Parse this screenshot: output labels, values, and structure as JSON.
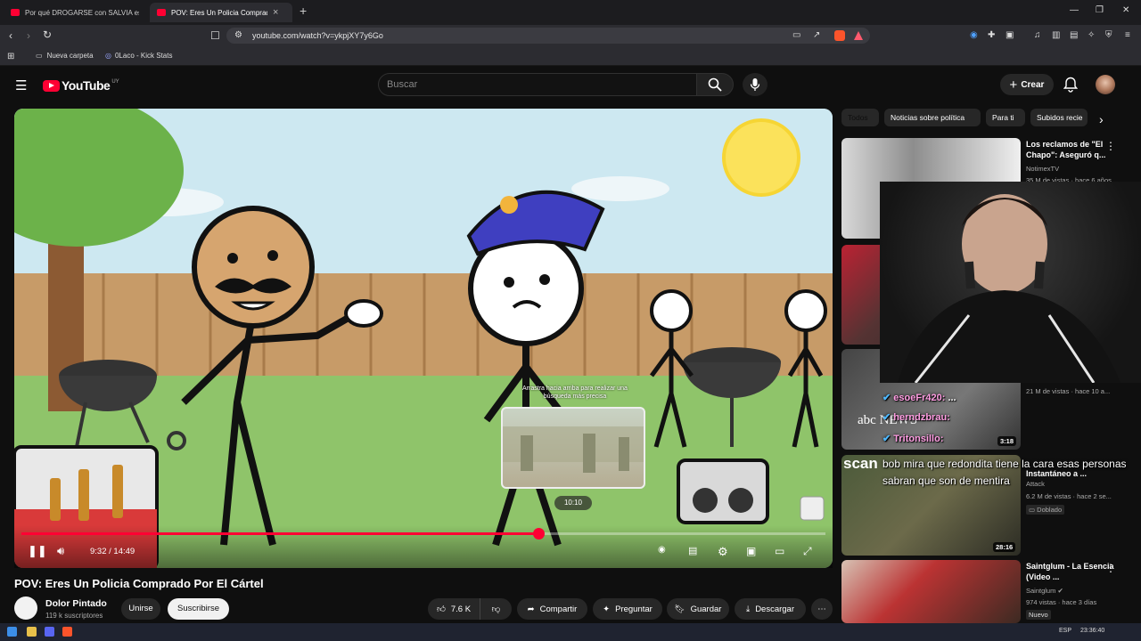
{
  "browser": {
    "tabs": [
      {
        "label": "Por qué DROGARSE con SALVIA es lo",
        "active": false
      },
      {
        "label": "POV: Eres Un Policia Comprado",
        "active": true
      }
    ],
    "url": "youtube.com/watch?v=ykpjXY7y6Go",
    "bookmarks": [
      "Nueva carpeta",
      "0Laco - Kick Stats"
    ]
  },
  "youtube": {
    "logo_text": "YouTube",
    "country": "UY",
    "search_placeholder": "Buscar",
    "create_label": "Crear"
  },
  "player": {
    "current_time": "9:32",
    "duration": "14:49",
    "time_display": "9:32 / 14:49",
    "progress_fraction": 0.643,
    "preview_time": "10:10",
    "drag_tip": "Arrastra hacia arriba para realizar una búsqueda más precisa"
  },
  "video": {
    "title": "POV: Eres Un Policia Comprado Por El Cártel",
    "channel": "Dolor Pintado",
    "subscribers": "119 k suscriptores",
    "join_label": "Unirse",
    "subscribe_label": "Suscribirse",
    "likes": "7.6 K",
    "share_label": "Compartir",
    "ask_label": "Preguntar",
    "save_label": "Guardar",
    "download_label": "Descargar"
  },
  "chips": [
    "Todos",
    "Noticias sobre política",
    "Para ti",
    "Subidos recie"
  ],
  "recommendations": [
    {
      "title": "Los reclamos de \"El Chapo\": Aseguró q...",
      "channel": "NotimexTV",
      "meta": "35 M de vistas · hace 6 años"
    },
    {
      "title": "",
      "channel": "",
      "meta": ""
    },
    {
      "title": "",
      "channel": "",
      "meta": "21 M de vistas · hace 10 a...",
      "duration": "3:18"
    },
    {
      "title": "Instantáneo a ...",
      "channel": "Attack",
      "meta": "6.2 M de vistas · hace 2 se...",
      "badge": "Doblado",
      "duration": "28:16"
    },
    {
      "title": "Saintglum - La Esencia (Video ...",
      "channel": "Saintglum",
      "meta": "974 vistas · hace 3 días",
      "badge": "Nuevo"
    }
  ],
  "overlay_chat": [
    {
      "user": "esoeFr420:",
      "text": "..."
    },
    {
      "user": "herndzbrau:",
      "text": ""
    },
    {
      "user": "Tritonsillo:",
      "text": ""
    }
  ],
  "overlay_message": "bob mira que redondita tiene la cara esas personas sabran que son de mentira",
  "thumb_texts": {
    "abc": "abc NEWS",
    "scan": "scan"
  },
  "taskbar": {
    "lang": "ESP",
    "time": "23:36:40"
  },
  "colors": {
    "accent": "#ff0033",
    "bg": "#0f0f0f"
  }
}
